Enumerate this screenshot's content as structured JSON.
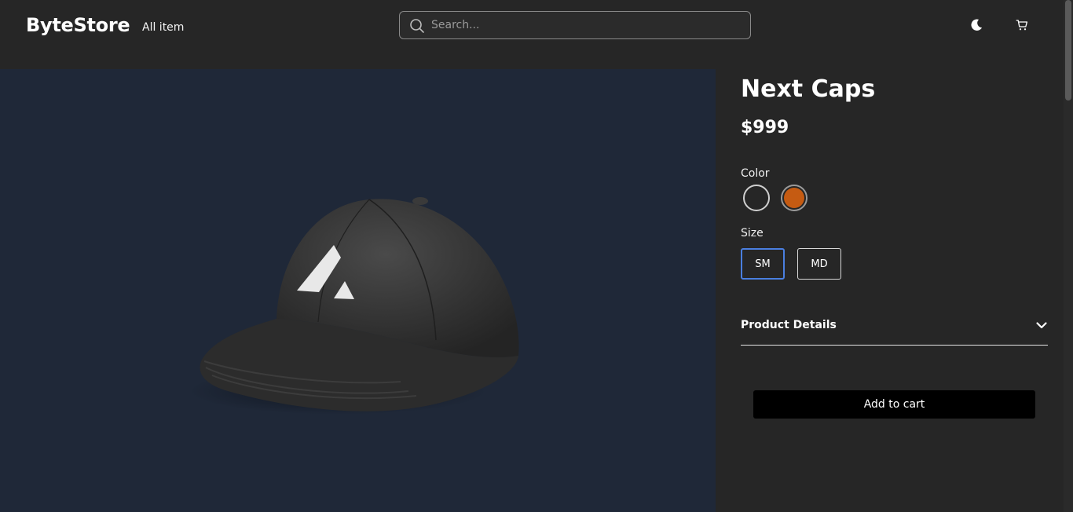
{
  "header": {
    "logo": "ByteStore",
    "nav_all_items": "All item",
    "search_placeholder": "Search...",
    "search_value": "",
    "theme_icon": "moon-icon",
    "cart_icon": "cart-icon"
  },
  "product": {
    "image_icon": "cap-image",
    "title": "Next Caps",
    "price": "$999",
    "color_label": "Color",
    "colors": [
      {
        "name": "black",
        "hex": "#262626",
        "selected": true
      },
      {
        "name": "orange",
        "hex": "#c55b12",
        "selected": false
      }
    ],
    "size_label": "Size",
    "sizes": [
      {
        "label": "SM",
        "selected": true
      },
      {
        "label": "MD",
        "selected": false
      }
    ],
    "details_label": "Product Details",
    "add_to_cart_label": "Add to cart"
  },
  "colors": {
    "background": "#262626",
    "image_panel": "#1f2838",
    "selected_size_border": "#4a7fe0",
    "button": "#000000"
  }
}
